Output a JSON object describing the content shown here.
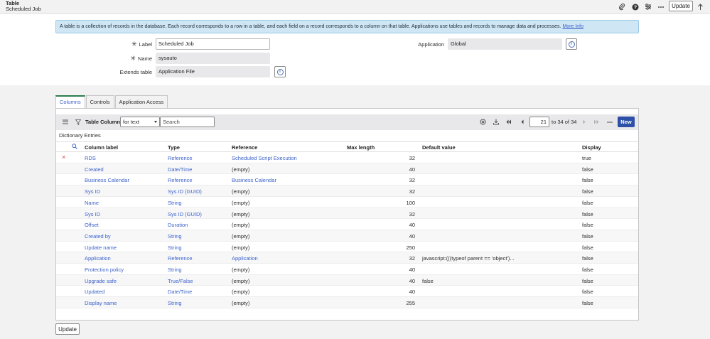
{
  "header": {
    "title": "Table",
    "subtitle": "Scheduled Job",
    "update_label": "Update",
    "icons": [
      "paperclip-icon",
      "help-icon",
      "sliders-icon",
      "more-icon",
      "arrow-up-icon"
    ]
  },
  "banner": {
    "text": "A table is a collection of records in the database. Each record corresponds to a row in a table, and each field on a record corresponds to a column on that table. Applications use tables and records to manage data and processes.",
    "link": "More Info"
  },
  "form": {
    "label_label": "Label",
    "label_value": "Scheduled Job",
    "name_label": "Name",
    "name_value": "sysauto",
    "extends_label": "Extends table",
    "extends_value": "Application File",
    "application_label": "Application",
    "application_value": "Global"
  },
  "tabs": [
    {
      "label": "Columns"
    },
    {
      "label": "Controls"
    },
    {
      "label": "Application Access"
    }
  ],
  "list": {
    "title": "Table Columns",
    "filter_select": "for text",
    "search_placeholder": "Search",
    "page_value": "21",
    "page_text": "to 34 of 34",
    "new_label": "New",
    "breadcrumb": "Dictionary Entries",
    "columns": [
      "Column label",
      "Type",
      "Reference",
      "Max length",
      "Default value",
      "Display"
    ],
    "rows": [
      {
        "label": "RDS",
        "type": "Reference",
        "reference": "Scheduled Script Execution",
        "ref_link": true,
        "max": "32",
        "default": "",
        "display": "true"
      },
      {
        "label": "Created",
        "type": "Date/Time",
        "reference": "(empty)",
        "ref_link": false,
        "max": "40",
        "default": "",
        "display": "false"
      },
      {
        "label": "Business Calendar",
        "type": "Reference",
        "reference": "Business Calendar",
        "ref_link": true,
        "max": "32",
        "default": "",
        "display": "false"
      },
      {
        "label": "Sys ID",
        "type": "Sys ID (GUID)",
        "reference": "(empty)",
        "ref_link": false,
        "max": "32",
        "default": "",
        "display": "false"
      },
      {
        "label": "Name",
        "type": "String",
        "reference": "(empty)",
        "ref_link": false,
        "max": "100",
        "default": "",
        "display": "false"
      },
      {
        "label": "Sys ID",
        "type": "Sys ID (GUID)",
        "reference": "(empty)",
        "ref_link": false,
        "max": "32",
        "default": "",
        "display": "false"
      },
      {
        "label": "Offset",
        "type": "Duration",
        "reference": "(empty)",
        "ref_link": false,
        "max": "40",
        "default": "",
        "display": "false"
      },
      {
        "label": "Created by",
        "type": "String",
        "reference": "(empty)",
        "ref_link": false,
        "max": "40",
        "default": "",
        "display": "false"
      },
      {
        "label": "Update name",
        "type": "String",
        "reference": "(empty)",
        "ref_link": false,
        "max": "250",
        "default": "",
        "display": "false"
      },
      {
        "label": "Application",
        "type": "Reference",
        "reference": "Application",
        "ref_link": true,
        "max": "32",
        "default": "javascript:(((typeof parent == 'object')...",
        "display": "false"
      },
      {
        "label": "Protection policy",
        "type": "String",
        "reference": "(empty)",
        "ref_link": false,
        "max": "40",
        "default": "",
        "display": "false"
      },
      {
        "label": "Upgrade safe",
        "type": "True/False",
        "reference": "(empty)",
        "ref_link": false,
        "max": "40",
        "default": "false",
        "display": "false"
      },
      {
        "label": "Updated",
        "type": "Date/Time",
        "reference": "(empty)",
        "ref_link": false,
        "max": "40",
        "default": "",
        "display": "false"
      },
      {
        "label": "Display name",
        "type": "String",
        "reference": "(empty)",
        "ref_link": false,
        "max": "255",
        "default": "",
        "display": "false"
      }
    ]
  },
  "footer": {
    "update_label": "Update"
  }
}
